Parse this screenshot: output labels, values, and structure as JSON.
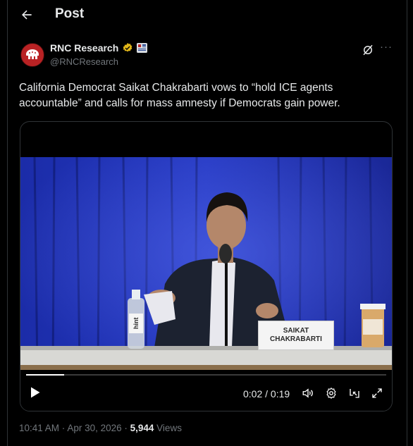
{
  "header": {
    "title": "Post",
    "back_icon": "arrow-left-icon"
  },
  "author": {
    "display_name": "RNC Research",
    "handle": "@RNCResearch",
    "verified_icon": "gold-verified-badge-icon",
    "affiliate_icon": "affiliate-badge-icon",
    "avatar_icon": "elephant-logo-icon"
  },
  "actions": {
    "grok_icon": "grok-icon",
    "more_label": "···"
  },
  "tweet": {
    "text": "California Democrat Saikat Chakrabarti vows to “hold ICE agents accountable” and calls for mass amnesty if Democrats gain power."
  },
  "video": {
    "name_tag_line1": "SAIKAT",
    "name_tag_line2": "CHAKRABARTI",
    "bottle_label": "hint",
    "time": "0:02 / 0:19",
    "progress": 0.105,
    "controls": [
      "play-icon",
      "volume-icon",
      "settings-gear-icon",
      "picture-in-picture-icon",
      "fullscreen-expand-icon"
    ]
  },
  "meta": {
    "time": "10:41 AM",
    "separator": " · ",
    "date": "Apr 30, 2026",
    "views_count": "5,944",
    "views_label": " Views"
  },
  "colors": {
    "background": "#000000",
    "text_primary": "#e7e9ea",
    "text_secondary": "#71767b",
    "border": "#2f3336",
    "curtain_blue": "#1a2a9a",
    "verified_gold": "#e2b719",
    "rnc_red": "#b92224"
  }
}
